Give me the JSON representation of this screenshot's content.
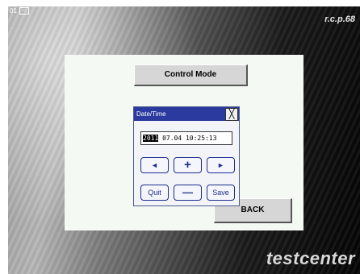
{
  "indicator": {
    "number": "01",
    "icon_name": "screen-icon",
    "icon_glyph": "▭"
  },
  "brand": {
    "top": "r.c.p.68",
    "bottom": "testcenter"
  },
  "panel": {
    "control_mode_label": "Control Mode",
    "back_label": "BACK"
  },
  "dialog": {
    "title": "Date/Time",
    "close_glyph": "╳",
    "year": "2011",
    "rest": " 07.04 10:25:13",
    "left_glyph": "◄",
    "plus_glyph": "+",
    "right_glyph": "►",
    "quit_label": "Quit",
    "minus_glyph": "—",
    "save_label": "Save"
  },
  "colors": {
    "title_bar": "#2a3a9e",
    "button_border": "#1e2e8c",
    "panel_bg": "#f4f9f4"
  }
}
